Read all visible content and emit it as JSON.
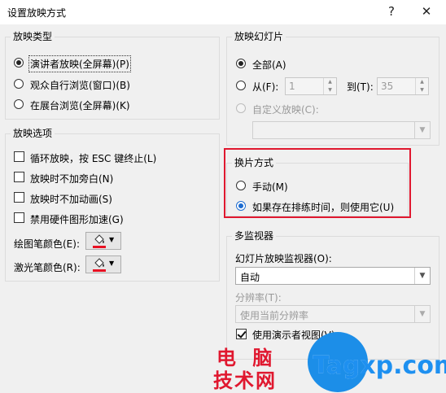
{
  "window": {
    "title": "设置放映方式",
    "help_label": "?",
    "close_label": "✕"
  },
  "show_type": {
    "title": "放映类型",
    "options": [
      {
        "label": "演讲者放映(全屏幕)(P)",
        "selected": true
      },
      {
        "label": "观众自行浏览(窗口)(B)",
        "selected": false
      },
      {
        "label": "在展台浏览(全屏幕)(K)",
        "selected": false
      }
    ]
  },
  "show_options": {
    "title": "放映选项",
    "checkboxes": [
      {
        "label": "循环放映，按 ESC 键终止(L)",
        "checked": false
      },
      {
        "label": "放映时不加旁白(N)",
        "checked": false
      },
      {
        "label": "放映时不加动画(S)",
        "checked": false
      },
      {
        "label": "禁用硬件图形加速(G)",
        "checked": false
      }
    ],
    "pen_color_label": "绘图笔颜色(E):",
    "laser_color_label": "激光笔颜色(R):",
    "pen_color": "#e81123",
    "laser_color": "#e81123"
  },
  "slides": {
    "title": "放映幻灯片",
    "all_label": "全部(A)",
    "from_label": "从(F):",
    "from_value": "1",
    "to_label": "到(T):",
    "to_value": "35",
    "custom_label": "自定义放映(C):",
    "custom_value": ""
  },
  "advance": {
    "title": "换片方式",
    "manual_label": "手动(M)",
    "timing_label": "如果存在排练时间，则使用它(U)",
    "selected": "timing"
  },
  "monitors": {
    "title": "多监视器",
    "monitor_label": "幻灯片放映监视器(O):",
    "monitor_value": "自动",
    "resolution_label": "分辨率(T):",
    "resolution_value": "使用当前分辨率",
    "presenter_view_label": "使用演示者视图(V)",
    "presenter_view_checked": true
  },
  "watermark": {
    "line1": "电 脑",
    "line2": "技术网",
    "site": "Tagxp.com"
  },
  "colors": {
    "accent_radio": "#1b6bd0",
    "highlight_border": "#e0182f",
    "dialog_bg": "#f0f0f0"
  }
}
